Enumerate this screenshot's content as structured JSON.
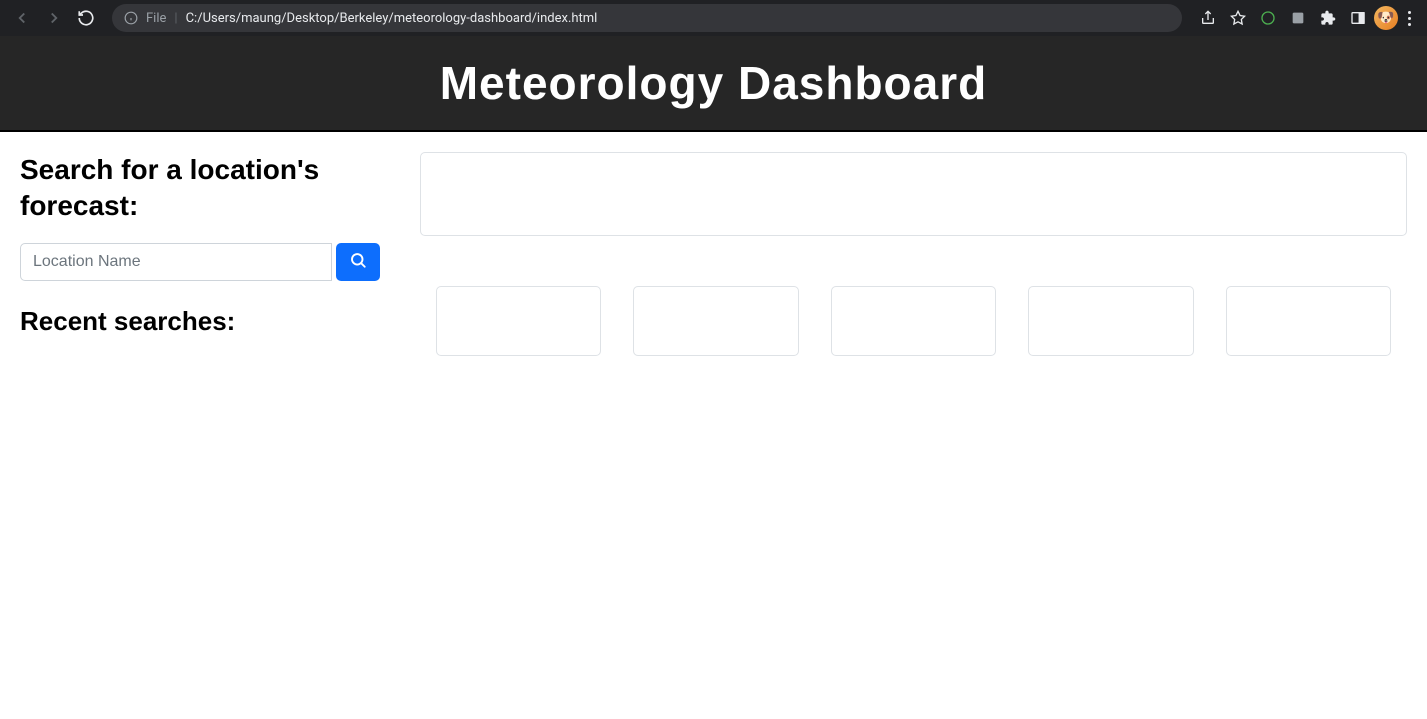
{
  "browser": {
    "address": {
      "file_label": "File",
      "url": "C:/Users/maung/Desktop/Berkeley/meteorology-dashboard/index.html"
    }
  },
  "header": {
    "title": "Meteorology Dashboard"
  },
  "sidebar": {
    "search_heading": "Search for a location's forecast:",
    "search_placeholder": "Location Name",
    "recent_heading": "Recent searches:"
  },
  "results": {
    "forecast_cards": [
      {},
      {},
      {},
      {},
      {}
    ]
  }
}
